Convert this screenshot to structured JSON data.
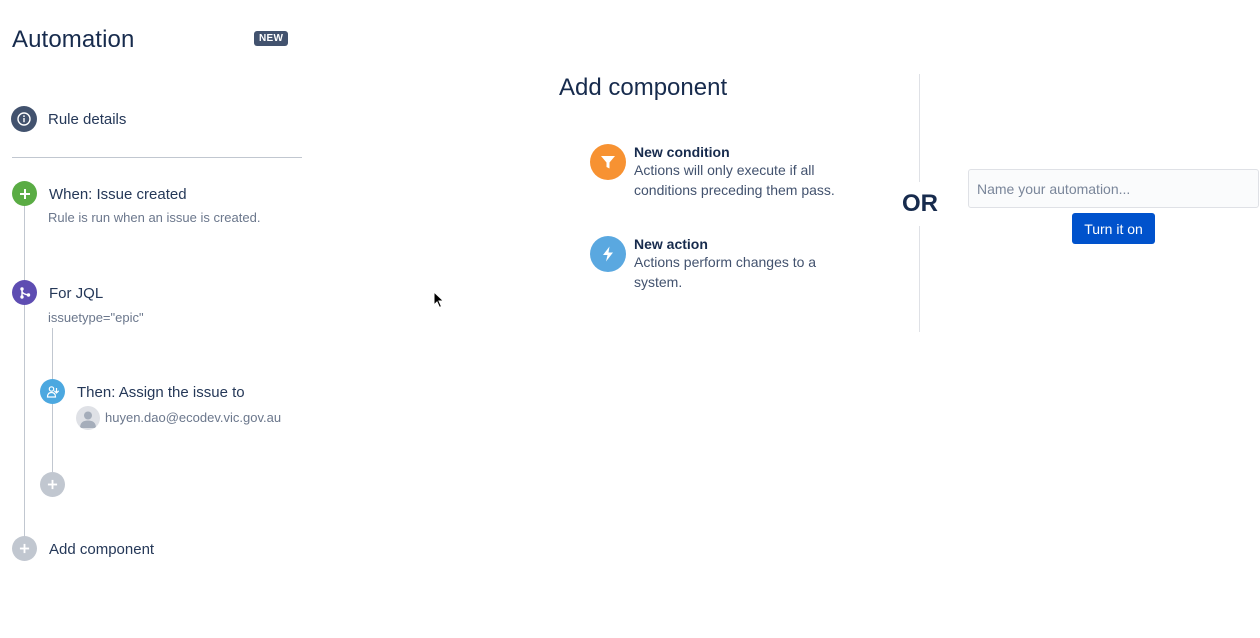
{
  "sidebar": {
    "title": "Automation",
    "badge": "NEW",
    "rule_details": {
      "label": "Rule details",
      "icon": "info-icon"
    },
    "trigger": {
      "title": "When: Issue created",
      "subtitle": "Rule is run when an issue is created.",
      "icon": "plus-icon"
    },
    "branch": {
      "title": "For JQL",
      "subtitle": "issuetype=\"epic\"",
      "icon": "branch-icon"
    },
    "action": {
      "title": "Then: Assign the issue to",
      "assignee": "huyen.dao@ecodev.vic.gov.au",
      "icon": "assign-user-icon"
    },
    "add_component": {
      "label": "Add component",
      "icon": "plus-icon"
    }
  },
  "main": {
    "title": "Add component",
    "options": [
      {
        "title": "New condition",
        "description": "Actions will only execute if all conditions preceding them pass.",
        "icon": "filter-icon",
        "color": "#f79232"
      },
      {
        "title": "New action",
        "description": "Actions perform changes to a system.",
        "icon": "lightning-icon",
        "color": "#5aa8e0"
      }
    ],
    "or_label": "OR",
    "name_input": {
      "placeholder": "Name your automation...",
      "value": ""
    },
    "turn_on_label": "Turn it on"
  },
  "colors": {
    "trigger": "#5aac44",
    "branch": "#5e4db2",
    "action": "#4ca8e0",
    "info": "#42526e",
    "disabled": "#c1c7d0",
    "primary": "#0052cc"
  }
}
